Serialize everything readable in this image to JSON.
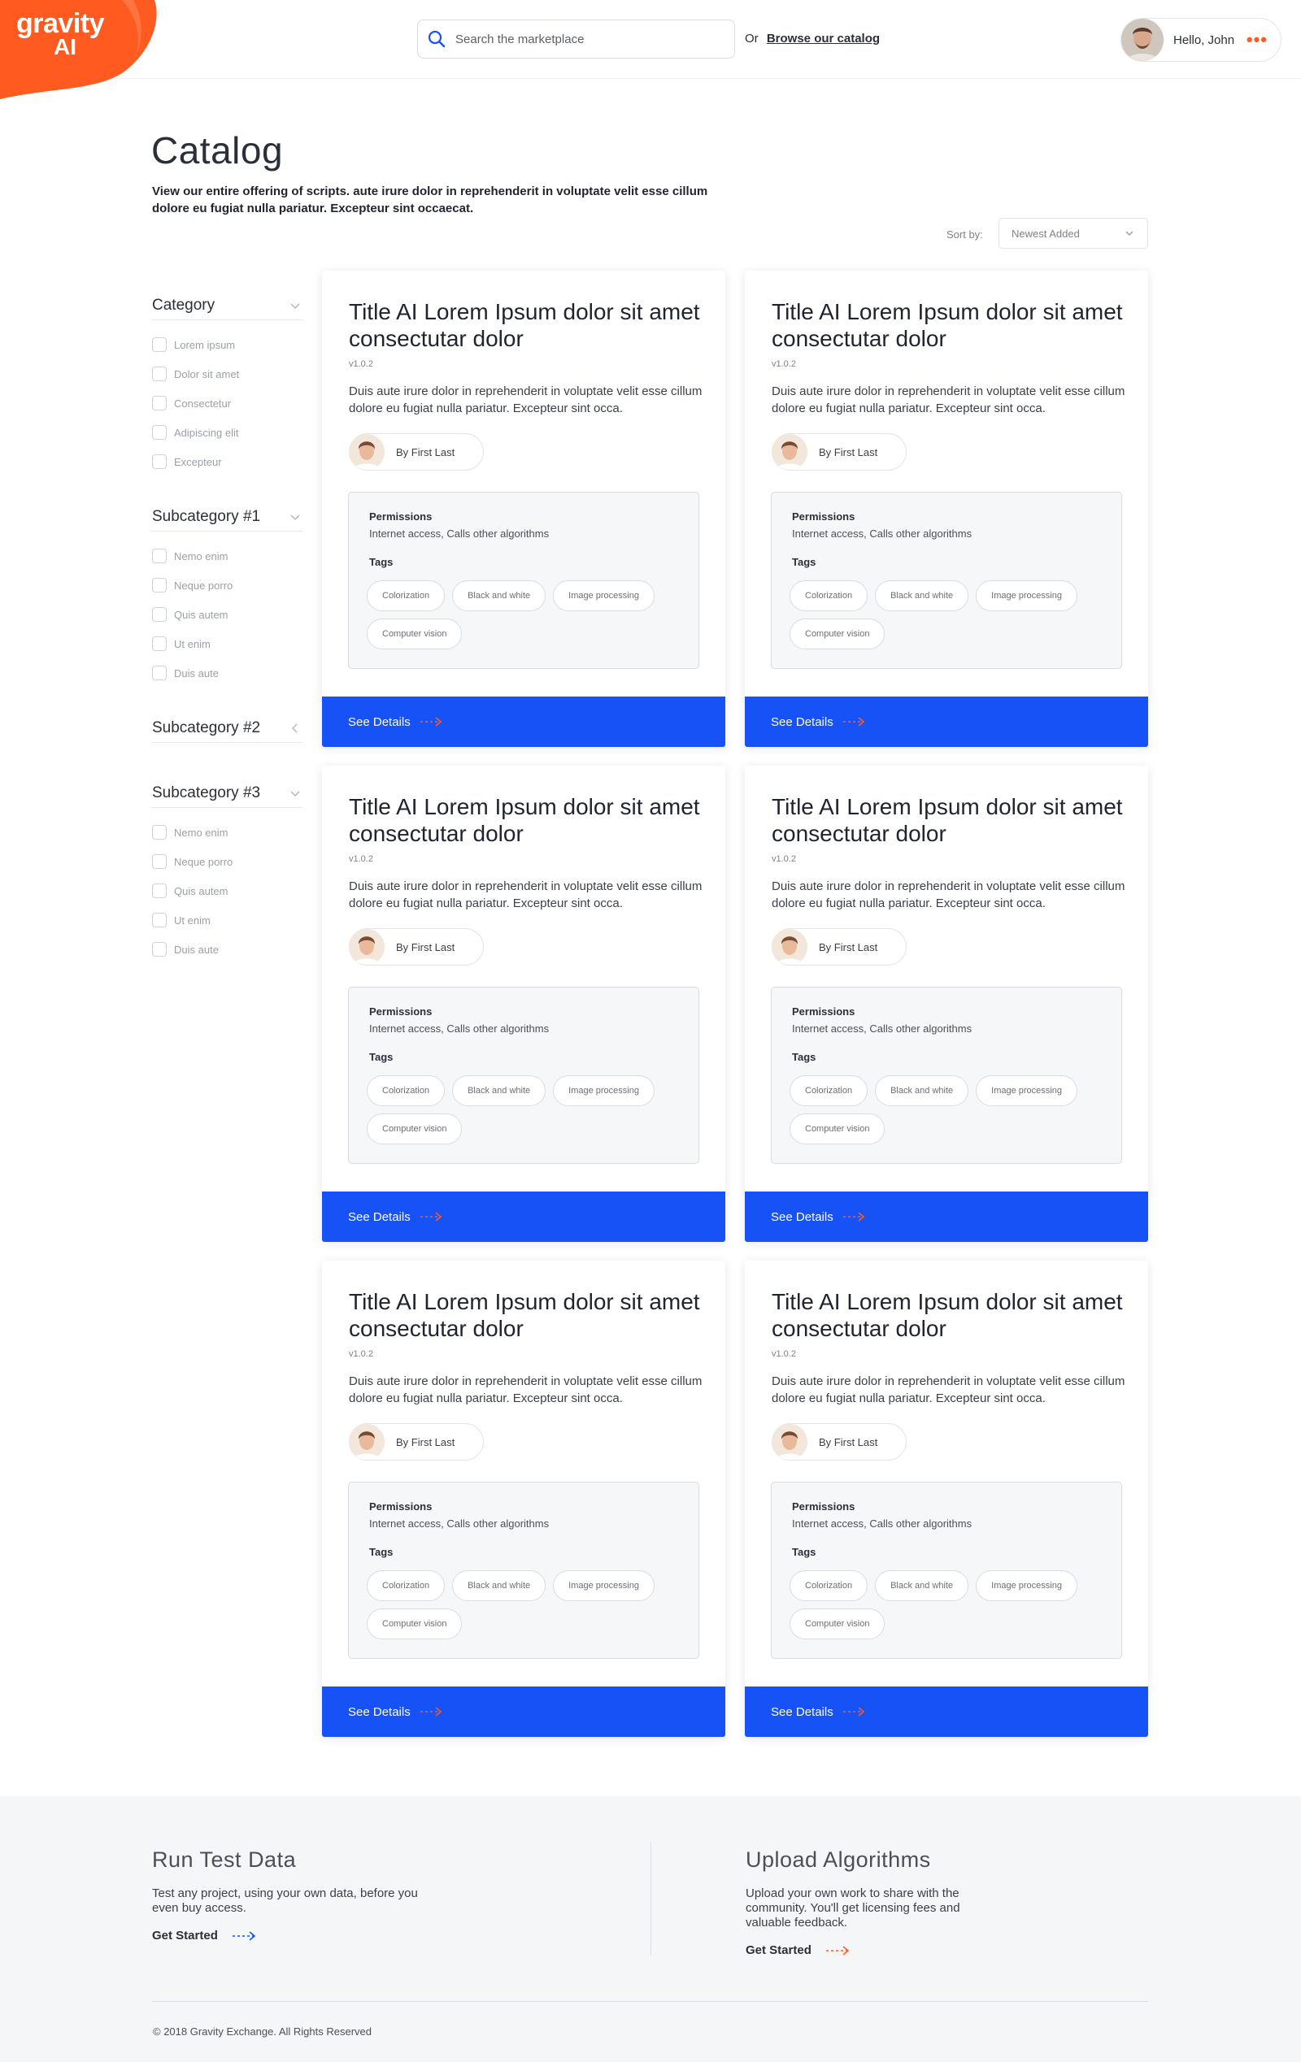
{
  "header": {
    "logo_line1": "gravity",
    "logo_line2": "AI",
    "search_placeholder": "Search the marketplace",
    "or_label": "Or",
    "browse_link": "Browse our catalog",
    "greeting": "Hello, John",
    "more_label": "•••"
  },
  "catalog": {
    "title": "Catalog",
    "description": "View our entire offering of scripts. aute irure dolor in reprehenderit in voluptate velit esse cillum dolore eu fugiat nulla pariatur. Excepteur sint occaecat.",
    "sort_label": "Sort by:",
    "sort_value": "Newest Added"
  },
  "sidebar": {
    "groups": [
      {
        "title": "Category",
        "items": [
          "Lorem ipsum",
          "Dolor sit amet",
          "Consectetur",
          "Adipiscing elit",
          "Excepteur"
        ]
      },
      {
        "title": "Subcategory #1",
        "items": [
          "Nemo enim",
          "Neque porro",
          "Quis autem",
          "Ut enim",
          "Duis aute"
        ]
      },
      {
        "title": "Subcategory #2",
        "items": []
      },
      {
        "title": "Subcategory #3",
        "items": [
          "Nemo enim",
          "Neque porro",
          "Quis autem",
          "Ut enim",
          "Duis aute"
        ]
      }
    ]
  },
  "cards": [
    {
      "title": "Title AI Lorem Ipsum dolor sit amet consectutar dolor",
      "version": "v1.0.2",
      "description": "Duis aute irure dolor in reprehenderit in voluptate velit esse cillum dolore eu fugiat nulla pariatur. Excepteur sint occa.",
      "author": "By First Last",
      "permissions_label": "Permissions",
      "permissions": "Internet access, Calls other algorithms",
      "tags_label": "Tags",
      "tags": [
        "Colorization",
        "Black and white",
        "Image processing",
        "Computer vision"
      ],
      "cta": "See Details"
    },
    {
      "title": "Title AI Lorem Ipsum dolor sit amet consectutar dolor",
      "version": "v1.0.2",
      "description": "Duis aute irure dolor in reprehenderit in voluptate velit esse cillum dolore eu fugiat nulla pariatur. Excepteur sint occa.",
      "author": "By First Last",
      "permissions_label": "Permissions",
      "permissions": "Internet access, Calls other algorithms",
      "tags_label": "Tags",
      "tags": [
        "Colorization",
        "Black and white",
        "Image processing",
        "Computer vision"
      ],
      "cta": "See Details"
    },
    {
      "title": "Title AI Lorem Ipsum dolor sit amet consectutar dolor",
      "version": "v1.0.2",
      "description": "Duis aute irure dolor in reprehenderit in voluptate velit esse cillum dolore eu fugiat nulla pariatur. Excepteur sint occa.",
      "author": "By First Last",
      "permissions_label": "Permissions",
      "permissions": "Internet access, Calls other algorithms",
      "tags_label": "Tags",
      "tags": [
        "Colorization",
        "Black and white",
        "Image processing",
        "Computer vision"
      ],
      "cta": "See Details"
    },
    {
      "title": "Title AI Lorem Ipsum dolor sit amet consectutar dolor",
      "version": "v1.0.2",
      "description": "Duis aute irure dolor in reprehenderit in voluptate velit esse cillum dolore eu fugiat nulla pariatur. Excepteur sint occa.",
      "author": "By First Last",
      "permissions_label": "Permissions",
      "permissions": "Internet access, Calls other algorithms",
      "tags_label": "Tags",
      "tags": [
        "Colorization",
        "Black and white",
        "Image processing",
        "Computer vision"
      ],
      "cta": "See Details"
    },
    {
      "title": "Title AI Lorem Ipsum dolor sit amet consectutar dolor",
      "version": "v1.0.2",
      "description": "Duis aute irure dolor in reprehenderit in voluptate velit esse cillum dolore eu fugiat nulla pariatur. Excepteur sint occa.",
      "author": "By First Last",
      "permissions_label": "Permissions",
      "permissions": "Internet access, Calls other algorithms",
      "tags_label": "Tags",
      "tags": [
        "Colorization",
        "Black and white",
        "Image processing",
        "Computer vision"
      ],
      "cta": "See Details"
    },
    {
      "title": "Title AI Lorem Ipsum dolor sit amet consectutar dolor",
      "version": "v1.0.2",
      "description": "Duis aute irure dolor in reprehenderit in voluptate velit esse cillum dolore eu fugiat nulla pariatur. Excepteur sint occa.",
      "author": "By First Last",
      "permissions_label": "Permissions",
      "permissions": "Internet access, Calls other algorithms",
      "tags_label": "Tags",
      "tags": [
        "Colorization",
        "Black and white",
        "Image processing",
        "Computer vision"
      ],
      "cta": "See Details"
    }
  ],
  "footer": {
    "promos": [
      {
        "title": "Run Test Data",
        "text": "Test any project, using your own data, before you even buy access.",
        "cta": "Get Started",
        "arrow_color": "#1652f5"
      },
      {
        "title": "Upload Algorithms",
        "text": "Upload your own work to share with the community. You'll get licensing fees and valuable feedback.",
        "cta": "Get Started",
        "arrow_color": "#ff5a1f"
      }
    ],
    "copyright": "© 2018 Gravity Exchange. All Rights Reserved"
  },
  "colors": {
    "brand_orange": "#ff5a1f",
    "primary_blue": "#1652f5",
    "text_dark": "#1f2430",
    "muted": "#9a9fa8"
  },
  "icons": {
    "search": "search-icon",
    "chevron": "chevron-down-icon",
    "arrow": "dashed-arrow-right-icon",
    "more": "more-dots-icon"
  }
}
